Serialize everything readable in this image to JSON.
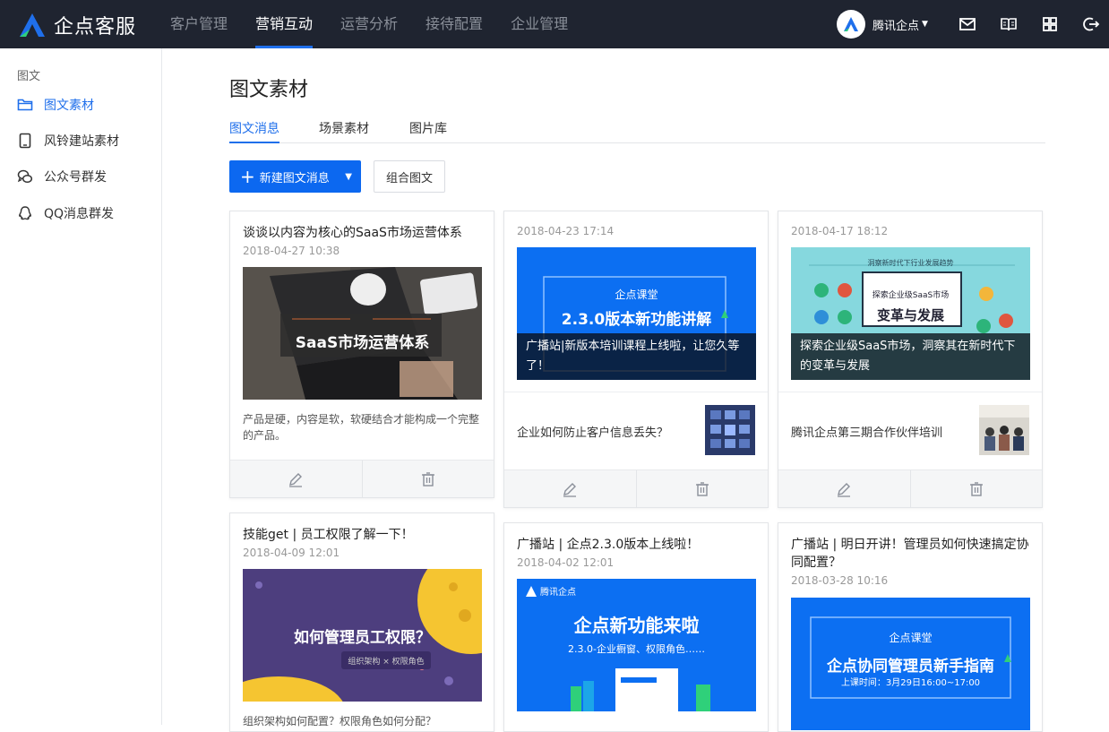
{
  "app": {
    "name": "企点客服"
  },
  "nav": {
    "items": [
      "客户管理",
      "营销互动",
      "运营分析",
      "接待配置",
      "企业管理"
    ],
    "active_index": 1
  },
  "user": {
    "name": "腾讯企点"
  },
  "toolbar_icons": [
    "mail-icon",
    "book-icon",
    "apps-grid-icon",
    "logout-icon"
  ],
  "sidebar": {
    "heading": "图文",
    "items": [
      {
        "label": "图文素材",
        "icon": "folder-icon",
        "active": true
      },
      {
        "label": "风铃建站素材",
        "icon": "tablet-icon",
        "active": false
      },
      {
        "label": "公众号群发",
        "icon": "wechat-icon",
        "active": false
      },
      {
        "label": "QQ消息群发",
        "icon": "qq-icon",
        "active": false
      }
    ]
  },
  "page": {
    "title": "图文素材",
    "tabs": [
      "图文消息",
      "场景素材",
      "图片库"
    ],
    "new_button": "新建图文消息",
    "combo_button": "组合图文"
  },
  "cards": [
    {
      "title": "谈谈以内容为核心的SaaS市场运营体系",
      "date": "2018-04-27 10:38",
      "cover_text": "SaaS市场运营体系",
      "desc": "产品是硬，内容是软，软硬结合才能构成一个完整的产品。"
    },
    {
      "date": "2018-04-23 17:14",
      "cover_small": "企点课堂",
      "cover_big": "2.3.0版本新功能讲解",
      "overlay": "广播站|新版本培训课程上线啦，让您久等了！",
      "sub_title": "企业如何防止客户信息丢失？"
    },
    {
      "date": "2018-04-17 18:12",
      "cover_top": "洞察新时代下行业发展趋势",
      "cover_small": "探索企业级SaaS市场",
      "cover_big": "变革与发展",
      "overlay": "探索企业级SaaS市场，洞察其在新时代下的变革与发展",
      "sub_title": "腾讯企点第三期合作伙伴培训"
    },
    {
      "title": "技能get | 员工权限了解一下！",
      "date": "2018-04-09 12:01",
      "cover_big": "如何管理员工权限？",
      "cover_small": "组织架构 × 权限角色",
      "desc": "组织架构如何配置？权限角色如何分配？"
    },
    {
      "title": "广播站 | 企点2.3.0版本上线啦！",
      "date": "2018-04-02 12:01",
      "cover_brand": "腾讯企点",
      "cover_big": "企点新功能来啦",
      "cover_small": "2.3.0-企业橱窗、权限角色……"
    },
    {
      "title": "广播站 | 明日开讲！管理员如何快速搞定协同配置？",
      "date": "2018-03-28 10:16",
      "cover_small": "企点课堂",
      "cover_big": "企点协同管理员新手指南",
      "cover_time": "上课时间：3月29日16:00~17:00"
    }
  ],
  "colors": {
    "topbar": "#1f2430",
    "accent": "#1f6feb",
    "button": "#0c68f0"
  }
}
